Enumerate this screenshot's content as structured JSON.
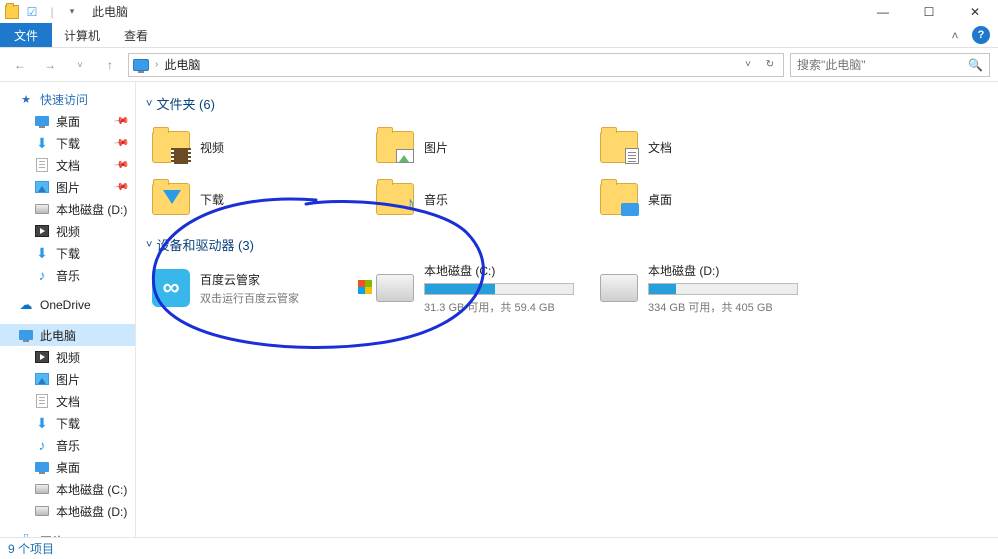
{
  "window": {
    "title": "此电脑",
    "controls": {
      "min": "—",
      "max": "☐",
      "close": "✕"
    }
  },
  "ribbon": {
    "file": "文件",
    "tabs": [
      "计算机",
      "查看"
    ],
    "help": "?"
  },
  "address": {
    "location": "此电脑",
    "sep": "›",
    "refresh": "↻",
    "drop": "˅"
  },
  "search": {
    "placeholder": "搜索\"此电脑\"",
    "icon": "🔍"
  },
  "sidebar": {
    "quick": "快速访问",
    "quick_items": [
      {
        "label": "桌面",
        "icon": "desktop",
        "pin": true
      },
      {
        "label": "下载",
        "icon": "down",
        "pin": true
      },
      {
        "label": "文档",
        "icon": "doc",
        "pin": true
      },
      {
        "label": "图片",
        "icon": "pic",
        "pin": true
      },
      {
        "label": "本地磁盘 (D:)",
        "icon": "disk"
      },
      {
        "label": "视频",
        "icon": "video"
      },
      {
        "label": "下载",
        "icon": "down"
      },
      {
        "label": "音乐",
        "icon": "music"
      }
    ],
    "onedrive": "OneDrive",
    "thispc": "此电脑",
    "thispc_items": [
      {
        "label": "视频",
        "icon": "video"
      },
      {
        "label": "图片",
        "icon": "pic"
      },
      {
        "label": "文档",
        "icon": "doc"
      },
      {
        "label": "下载",
        "icon": "down"
      },
      {
        "label": "音乐",
        "icon": "music"
      },
      {
        "label": "桌面",
        "icon": "desktop"
      },
      {
        "label": "本地磁盘 (C:)",
        "icon": "disk"
      },
      {
        "label": "本地磁盘 (D:)",
        "icon": "disk"
      }
    ],
    "network": "网络"
  },
  "groups": {
    "folders": {
      "label": "文件夹 (6)"
    },
    "devices": {
      "label": "设备和驱动器 (3)"
    }
  },
  "folders": [
    {
      "label": "视频",
      "ov": "film"
    },
    {
      "label": "图片",
      "ov": "pic"
    },
    {
      "label": "文档",
      "ov": "doc"
    },
    {
      "label": "下载",
      "ov": "down"
    },
    {
      "label": "音乐",
      "ov": "music"
    },
    {
      "label": "桌面",
      "ov": "desktop"
    }
  ],
  "devices": {
    "baidu": {
      "label": "百度云管家",
      "sub": "双击运行百度云管家",
      "glyph": "∞"
    },
    "c": {
      "label": "本地磁盘 (C:)",
      "free": "31.3 GB 可用，共 59.4 GB",
      "pct": 47
    },
    "d": {
      "label": "本地磁盘 (D:)",
      "free": "334 GB 可用，共 405 GB",
      "pct": 18
    }
  },
  "status": "9 个项目"
}
